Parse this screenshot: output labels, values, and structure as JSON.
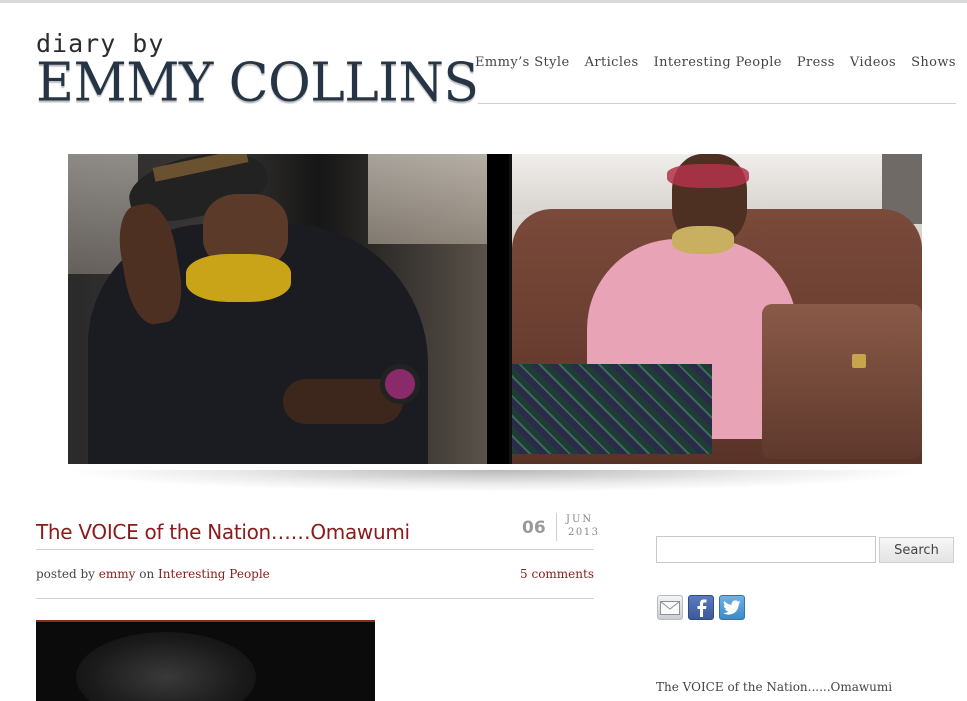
{
  "site": {
    "logo_small": "diary by",
    "logo_big": "EMMY COLLINS"
  },
  "nav": {
    "items": [
      "Emmy’s Style",
      "Articles",
      "Interesting People",
      "Press",
      "Videos",
      "Shows"
    ]
  },
  "post": {
    "title": "The VOICE of the Nation……Omawumi",
    "day": "06",
    "month": "JUN",
    "year": "2013",
    "posted_by_prefix": "posted by",
    "author": "emmy",
    "on_word": "on",
    "category": "Interesting People",
    "comments": "5 comments"
  },
  "sidebar": {
    "search_placeholder": "",
    "search_button": "Search",
    "social_icons": [
      "mail-icon",
      "facebook-icon",
      "twitter-icon"
    ],
    "recent_post": "The VOICE of the Nation......Omawumi"
  },
  "colors": {
    "accent": "#8b1a1a",
    "logo": "#253545"
  }
}
